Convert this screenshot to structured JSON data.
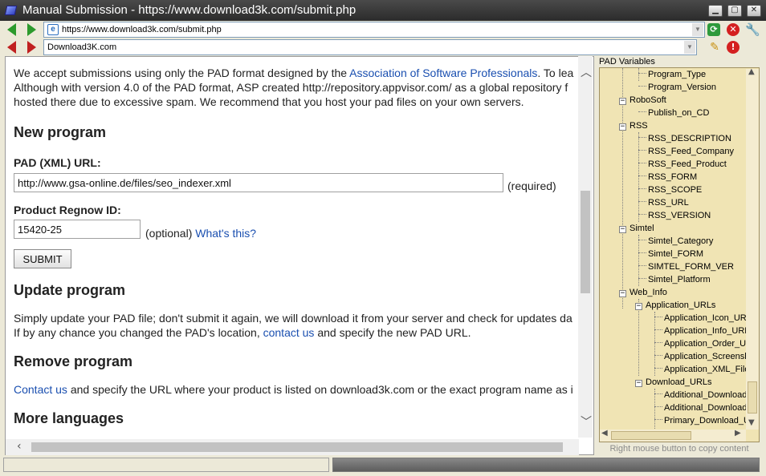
{
  "window": {
    "title": "Manual Submission - https://www.download3k.com/submit.php"
  },
  "toolbar": {
    "url": "https://www.download3k.com/submit.php",
    "site_field": "Download3K.com"
  },
  "content": {
    "intro": {
      "line1_pre": "We accept submissions using only the PAD format designed by the ",
      "line1_link": "Association of Software Professionals",
      "line1_post": ". To lea",
      "line2": "Although with version 4.0 of the PAD format, ASP created http://repository.appvisor.com/ as a global repository f",
      "line3": "hosted there due to excessive spam. We recommend that you host your pad files on your own servers."
    },
    "new_program": {
      "heading": "New program",
      "pad_label": "PAD (XML) URL:",
      "pad_value": "http://www.gsa-online.de/files/seo_indexer.xml",
      "pad_note": "(required)",
      "regnow_label": "Product Regnow ID:",
      "regnow_value": "15420-25",
      "regnow_note": "(optional)",
      "whats_this": "What's this?",
      "submit_label": "SUBMIT"
    },
    "update_program": {
      "heading": "Update program",
      "line1": "Simply update your PAD file; don't submit it again, we will download it from your server and check for updates da",
      "line2_pre": "If by any chance you changed the PAD's location, ",
      "line2_link": "contact us",
      "line2_post": " and specify the new PAD URL."
    },
    "remove_program": {
      "heading": "Remove program",
      "link": "Contact us",
      "text": " and specify the URL where your product is listed on download3k.com or the exact program name as i"
    },
    "more_languages": {
      "heading": "More languages"
    }
  },
  "pad_panel": {
    "header": "PAD Variables",
    "footer": "Right mouse button to copy content",
    "tree": [
      {
        "label": "Program_Type",
        "level": 2,
        "kind": "leaf"
      },
      {
        "label": "Program_Version",
        "level": 2,
        "kind": "leaf"
      },
      {
        "label": "RoboSoft",
        "level": 1,
        "kind": "group"
      },
      {
        "label": "Publish_on_CD",
        "level": 2,
        "kind": "leaf"
      },
      {
        "label": "RSS",
        "level": 1,
        "kind": "group"
      },
      {
        "label": "RSS_DESCRIPTION",
        "level": 2,
        "kind": "leaf"
      },
      {
        "label": "RSS_Feed_Company",
        "level": 2,
        "kind": "leaf"
      },
      {
        "label": "RSS_Feed_Product",
        "level": 2,
        "kind": "leaf"
      },
      {
        "label": "RSS_FORM",
        "level": 2,
        "kind": "leaf"
      },
      {
        "label": "RSS_SCOPE",
        "level": 2,
        "kind": "leaf"
      },
      {
        "label": "RSS_URL",
        "level": 2,
        "kind": "leaf"
      },
      {
        "label": "RSS_VERSION",
        "level": 2,
        "kind": "leaf"
      },
      {
        "label": "Simtel",
        "level": 1,
        "kind": "group"
      },
      {
        "label": "Simtel_Category",
        "level": 2,
        "kind": "leaf"
      },
      {
        "label": "Simtel_FORM",
        "level": 2,
        "kind": "leaf"
      },
      {
        "label": "SIMTEL_FORM_VER",
        "level": 2,
        "kind": "leaf"
      },
      {
        "label": "Simtel_Platform",
        "level": 2,
        "kind": "leaf"
      },
      {
        "label": "Web_Info",
        "level": 1,
        "kind": "group"
      },
      {
        "label": "Application_URLs",
        "level": 2,
        "kind": "group"
      },
      {
        "label": "Application_Icon_URl",
        "level": 3,
        "kind": "leaf"
      },
      {
        "label": "Application_Info_URL",
        "level": 3,
        "kind": "leaf"
      },
      {
        "label": "Application_Order_UF",
        "level": 3,
        "kind": "leaf"
      },
      {
        "label": "Application_Screensh",
        "level": 3,
        "kind": "leaf"
      },
      {
        "label": "Application_XML_File",
        "level": 3,
        "kind": "leaf"
      },
      {
        "label": "Download_URLs",
        "level": 2,
        "kind": "group"
      },
      {
        "label": "Additional_Download_",
        "level": 3,
        "kind": "leaf"
      },
      {
        "label": "Additional_Download_",
        "level": 3,
        "kind": "leaf"
      },
      {
        "label": "Primary_Download_U",
        "level": 3,
        "kind": "leaf"
      }
    ]
  },
  "colors": {
    "link": "#1a4fb0",
    "tree_bg": "#f0e4b4"
  }
}
